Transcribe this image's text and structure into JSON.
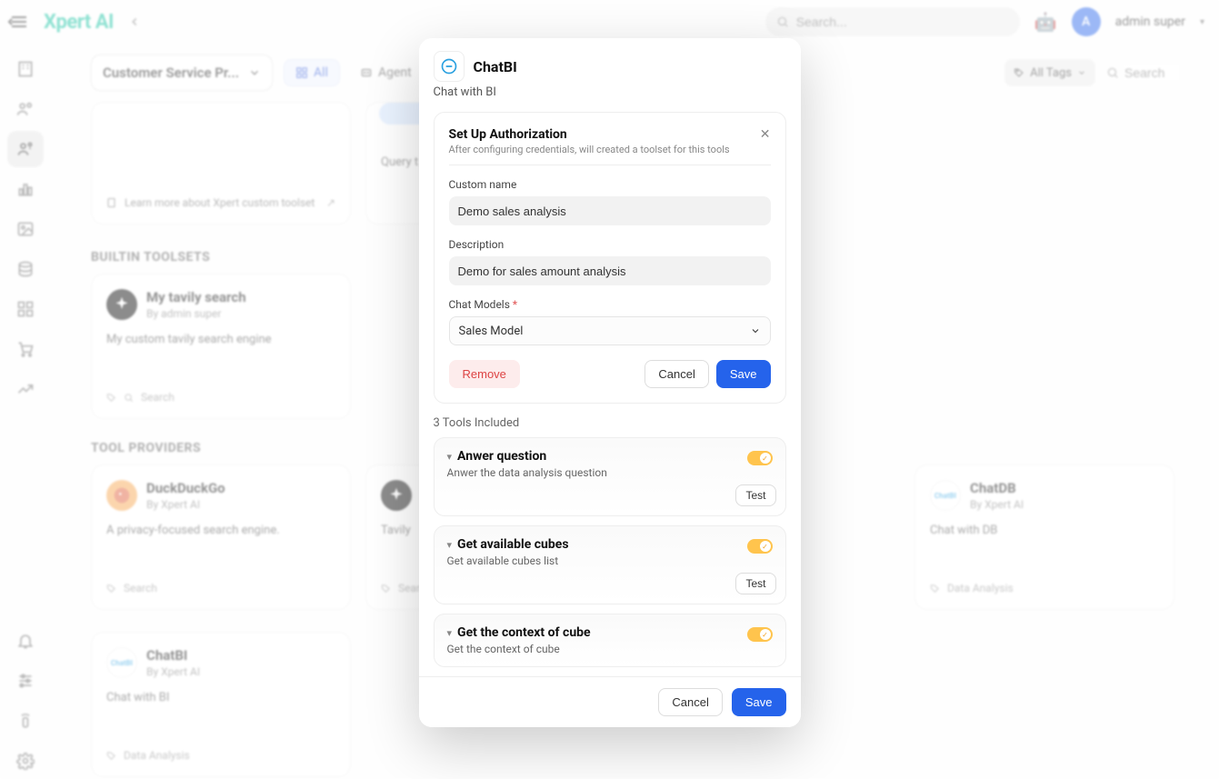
{
  "brand": {
    "name": "Xpert AI"
  },
  "topbar": {
    "search_placeholder": "Search...",
    "robot_emoji": "🤖",
    "user_initial": "A",
    "user_name": "admin super"
  },
  "controls": {
    "actor_select": "Customer Service Pr...",
    "all_pill": "All",
    "agent_pill": "Agent",
    "all_tags": "All Tags",
    "search_placeholder": "Search"
  },
  "partial_cards": {
    "learn_more": "Learn more about Xpert custom toolset",
    "query_text": "Query t"
  },
  "sections": {
    "builtin_title": "BUILTIN TOOLSETS",
    "providers_title": "TOOL PROVIDERS"
  },
  "builtin_card": {
    "title": "My tavily search",
    "by": "By admin super",
    "desc": "My custom tavily search engine",
    "tag": "Search"
  },
  "providers": [
    {
      "title": "DuckDuckGo",
      "by": "By Xpert AI",
      "desc": "A privacy-focused search engine.",
      "tag": "Search",
      "icon_bg": "#f7a34a",
      "icon_text": ""
    },
    {
      "title": "",
      "by": "",
      "desc": "Tavily",
      "tag": "Searc",
      "icon_bg": "#000",
      "icon_text": ""
    },
    {
      "title": "",
      "by": "",
      "desc": "",
      "tag": "",
      "icon_bg": "",
      "icon_text": ""
    },
    {
      "title": "ChatDB",
      "by": "By Xpert AI",
      "desc": "Chat with DB",
      "tag": "Data Analysis",
      "icon_bg": "#fff",
      "icon_text": "ChatBI"
    }
  ],
  "provider_chatbi": {
    "title": "ChatBI",
    "by": "By Xpert AI",
    "desc": "Chat with BI",
    "tag": "Data Analysis"
  },
  "modal": {
    "logo_text": "ChatBI",
    "title": "ChatBI",
    "subtitle": "Chat with BI",
    "auth": {
      "title": "Set Up Authorization",
      "desc": "After configuring credentials, will created a toolset for this tools",
      "custom_name_label": "Custom name",
      "custom_name_value": "Demo sales analysis",
      "description_label": "Description",
      "description_value": "Demo for sales amount analysis",
      "chat_models_label": "Chat Models",
      "chat_models_value": "Sales Model",
      "remove": "Remove",
      "cancel": "Cancel",
      "save": "Save"
    },
    "tools_count": "3 Tools Included",
    "tools": [
      {
        "title": "Anwer question",
        "desc": "Anwer the data analysis question",
        "test": "Test"
      },
      {
        "title": "Get available cubes",
        "desc": "Get available cubes list",
        "test": "Test"
      },
      {
        "title": "Get the context of cube",
        "desc": "Get the context of cube",
        "test": ""
      }
    ],
    "footer_cancel": "Cancel",
    "footer_save": "Save"
  }
}
